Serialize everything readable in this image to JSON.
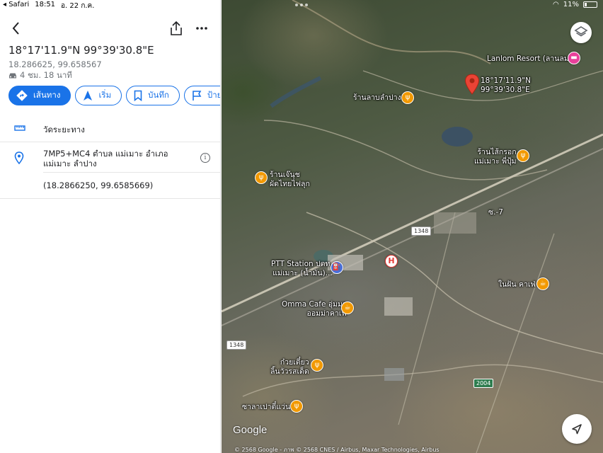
{
  "status_bar": {
    "app": "Safari",
    "time": "18:51",
    "date": "อ. 22 ก.ค.",
    "battery": "11%"
  },
  "place": {
    "title": "18°17'11.9\"N 99°39'30.8\"E",
    "decimal_short": "18.286625, 99.658567",
    "drive_time": "4 ชม. 18 นาที"
  },
  "actions": {
    "directions": "เส้นทาง",
    "start": "เริ่ม",
    "save": "บันทึก",
    "label": "ป้ายกำ"
  },
  "details": {
    "measure": "วัดระยะทาง",
    "address_line1": "7MP5+MC4 ตำบล แม่เมาะ อำเภอ",
    "address_line2": "แม่เมาะ ลำปาง",
    "decimal_full": "(18.2866250, 99.6585669)"
  },
  "map": {
    "pin_label_1": "18°17'11.9\"N",
    "pin_label_2": "99°39'30.8\"E",
    "places": {
      "lanlom": "Lanlom Resort (ลานลม)",
      "lamlampang": "ร้านลาบลำปาง",
      "saikrok_1": "ร้านไส้กรอก",
      "saikrok_2": "แม่เมาะ พี่ปุ้ม",
      "jeanuch_1": "ร้านเจ๊นุช",
      "jeanuch_2": "ผัดไทยไฟลุก",
      "soi7": "ซ.-7",
      "ptt_1": "PTT Station ปตท.",
      "ptt_2": "แม่เมาะ (น้ำมัน)...",
      "nainfhun": "ในฝัน คาเฟ่",
      "omma_1": "Omma Cafe อุ่มมา",
      "omma_2": "ออมม่าคาเฟ่",
      "kuay_1": "ก๋วยเตี๋ยว",
      "kuay_2": "ลิ้นวัวรสเด็ด",
      "salapao": "ซาลาเปาตี๋แว่น"
    },
    "road_1348_a": "1348",
    "road_1348_b": "1348",
    "road_2004": "2004",
    "google": "Google",
    "attribution": "© 2568 Google - ภาพ © 2568 CNES / Airbus, Maxar Technologies, Airbus"
  },
  "colors": {
    "accent": "#1a73e8",
    "poi": "#f29900",
    "pin": "#ea4335"
  }
}
